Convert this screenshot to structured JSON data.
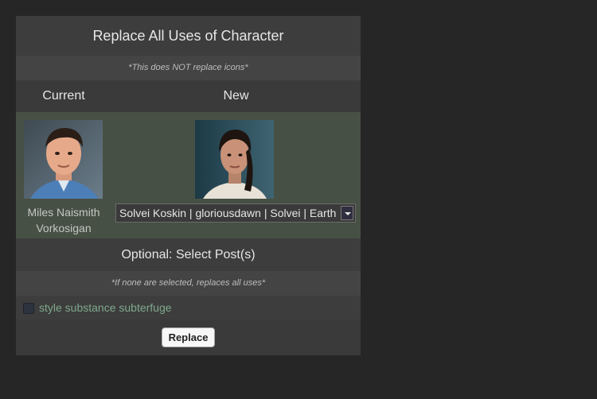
{
  "dialog": {
    "title": "Replace All Uses of Character",
    "icons_note": "*This does NOT replace icons*",
    "headers": {
      "current": "Current",
      "new": "New"
    },
    "current_name": "Miles Naismith Vorkosigan",
    "new_select_value": "Solvei Koskin | gloriousdawn | Solvei | Earth",
    "optional_heading": "Optional: Select Post(s)",
    "posts_note": "*If none are selected, replaces all uses*",
    "posts": [
      {
        "label": "style substance subterfuge",
        "checked": false
      }
    ],
    "replace_label": "Replace"
  },
  "colors": {
    "page_bg": "#262626",
    "panel_bg": "#3a3a3a",
    "character_row_bg": "#475044",
    "post_label": "#7fa88c"
  }
}
